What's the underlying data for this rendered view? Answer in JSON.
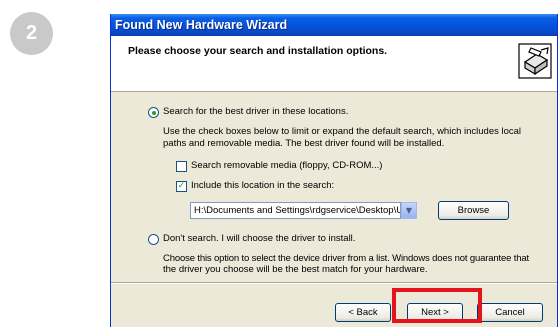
{
  "step_number": "2",
  "window": {
    "title": "Found New Hardware Wizard"
  },
  "header": {
    "title": "Please choose your search and installation options.",
    "icon": "hardware-install-icon"
  },
  "options": {
    "search": {
      "label": "Search for the best driver in these locations.",
      "selected": true,
      "description_line1": "Use the check boxes below to limit or expand the default search, which includes local",
      "description_line2": "paths and removable media. The best driver found will be installed.",
      "removable_media": {
        "label": "Search removable media (floppy, CD-ROM...)",
        "checked": false
      },
      "include_location": {
        "label": "Include this location in the search:",
        "checked": true,
        "path_value": "H:\\Documents and Settings\\rdgservice\\Desktop\\Up",
        "browse_label": "Browse"
      }
    },
    "dont_search": {
      "label": "Don't search. I will choose the driver to install.",
      "selected": false,
      "description_line1": "Choose this option to select the device driver from a list.  Windows does not guarantee that",
      "description_line2": "the driver you choose will be the best match for your hardware."
    }
  },
  "buttons": {
    "back": "< Back",
    "next": "Next >",
    "cancel": "Cancel"
  },
  "colors": {
    "highlight": "#e3141c",
    "titlebar": "#0553dc",
    "dialog_bg": "#ece9d8"
  }
}
